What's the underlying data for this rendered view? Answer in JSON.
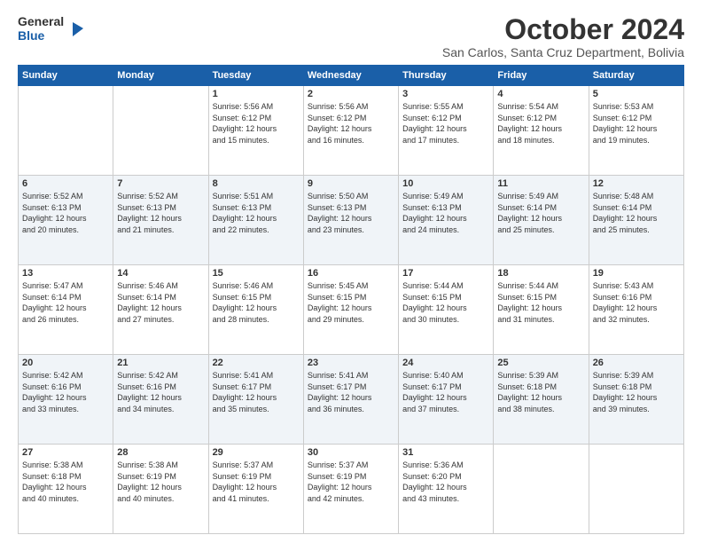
{
  "logo": {
    "line1": "General",
    "line2": "Blue"
  },
  "header": {
    "month": "October 2024",
    "location": "San Carlos, Santa Cruz Department, Bolivia"
  },
  "days_of_week": [
    "Sunday",
    "Monday",
    "Tuesday",
    "Wednesday",
    "Thursday",
    "Friday",
    "Saturday"
  ],
  "weeks": [
    [
      {
        "day": "",
        "info": ""
      },
      {
        "day": "",
        "info": ""
      },
      {
        "day": "1",
        "info": "Sunrise: 5:56 AM\nSunset: 6:12 PM\nDaylight: 12 hours\nand 15 minutes."
      },
      {
        "day": "2",
        "info": "Sunrise: 5:56 AM\nSunset: 6:12 PM\nDaylight: 12 hours\nand 16 minutes."
      },
      {
        "day": "3",
        "info": "Sunrise: 5:55 AM\nSunset: 6:12 PM\nDaylight: 12 hours\nand 17 minutes."
      },
      {
        "day": "4",
        "info": "Sunrise: 5:54 AM\nSunset: 6:12 PM\nDaylight: 12 hours\nand 18 minutes."
      },
      {
        "day": "5",
        "info": "Sunrise: 5:53 AM\nSunset: 6:12 PM\nDaylight: 12 hours\nand 19 minutes."
      }
    ],
    [
      {
        "day": "6",
        "info": "Sunrise: 5:52 AM\nSunset: 6:13 PM\nDaylight: 12 hours\nand 20 minutes."
      },
      {
        "day": "7",
        "info": "Sunrise: 5:52 AM\nSunset: 6:13 PM\nDaylight: 12 hours\nand 21 minutes."
      },
      {
        "day": "8",
        "info": "Sunrise: 5:51 AM\nSunset: 6:13 PM\nDaylight: 12 hours\nand 22 minutes."
      },
      {
        "day": "9",
        "info": "Sunrise: 5:50 AM\nSunset: 6:13 PM\nDaylight: 12 hours\nand 23 minutes."
      },
      {
        "day": "10",
        "info": "Sunrise: 5:49 AM\nSunset: 6:13 PM\nDaylight: 12 hours\nand 24 minutes."
      },
      {
        "day": "11",
        "info": "Sunrise: 5:49 AM\nSunset: 6:14 PM\nDaylight: 12 hours\nand 25 minutes."
      },
      {
        "day": "12",
        "info": "Sunrise: 5:48 AM\nSunset: 6:14 PM\nDaylight: 12 hours\nand 25 minutes."
      }
    ],
    [
      {
        "day": "13",
        "info": "Sunrise: 5:47 AM\nSunset: 6:14 PM\nDaylight: 12 hours\nand 26 minutes."
      },
      {
        "day": "14",
        "info": "Sunrise: 5:46 AM\nSunset: 6:14 PM\nDaylight: 12 hours\nand 27 minutes."
      },
      {
        "day": "15",
        "info": "Sunrise: 5:46 AM\nSunset: 6:15 PM\nDaylight: 12 hours\nand 28 minutes."
      },
      {
        "day": "16",
        "info": "Sunrise: 5:45 AM\nSunset: 6:15 PM\nDaylight: 12 hours\nand 29 minutes."
      },
      {
        "day": "17",
        "info": "Sunrise: 5:44 AM\nSunset: 6:15 PM\nDaylight: 12 hours\nand 30 minutes."
      },
      {
        "day": "18",
        "info": "Sunrise: 5:44 AM\nSunset: 6:15 PM\nDaylight: 12 hours\nand 31 minutes."
      },
      {
        "day": "19",
        "info": "Sunrise: 5:43 AM\nSunset: 6:16 PM\nDaylight: 12 hours\nand 32 minutes."
      }
    ],
    [
      {
        "day": "20",
        "info": "Sunrise: 5:42 AM\nSunset: 6:16 PM\nDaylight: 12 hours\nand 33 minutes."
      },
      {
        "day": "21",
        "info": "Sunrise: 5:42 AM\nSunset: 6:16 PM\nDaylight: 12 hours\nand 34 minutes."
      },
      {
        "day": "22",
        "info": "Sunrise: 5:41 AM\nSunset: 6:17 PM\nDaylight: 12 hours\nand 35 minutes."
      },
      {
        "day": "23",
        "info": "Sunrise: 5:41 AM\nSunset: 6:17 PM\nDaylight: 12 hours\nand 36 minutes."
      },
      {
        "day": "24",
        "info": "Sunrise: 5:40 AM\nSunset: 6:17 PM\nDaylight: 12 hours\nand 37 minutes."
      },
      {
        "day": "25",
        "info": "Sunrise: 5:39 AM\nSunset: 6:18 PM\nDaylight: 12 hours\nand 38 minutes."
      },
      {
        "day": "26",
        "info": "Sunrise: 5:39 AM\nSunset: 6:18 PM\nDaylight: 12 hours\nand 39 minutes."
      }
    ],
    [
      {
        "day": "27",
        "info": "Sunrise: 5:38 AM\nSunset: 6:18 PM\nDaylight: 12 hours\nand 40 minutes."
      },
      {
        "day": "28",
        "info": "Sunrise: 5:38 AM\nSunset: 6:19 PM\nDaylight: 12 hours\nand 40 minutes."
      },
      {
        "day": "29",
        "info": "Sunrise: 5:37 AM\nSunset: 6:19 PM\nDaylight: 12 hours\nand 41 minutes."
      },
      {
        "day": "30",
        "info": "Sunrise: 5:37 AM\nSunset: 6:19 PM\nDaylight: 12 hours\nand 42 minutes."
      },
      {
        "day": "31",
        "info": "Sunrise: 5:36 AM\nSunset: 6:20 PM\nDaylight: 12 hours\nand 43 minutes."
      },
      {
        "day": "",
        "info": ""
      },
      {
        "day": "",
        "info": ""
      }
    ]
  ]
}
